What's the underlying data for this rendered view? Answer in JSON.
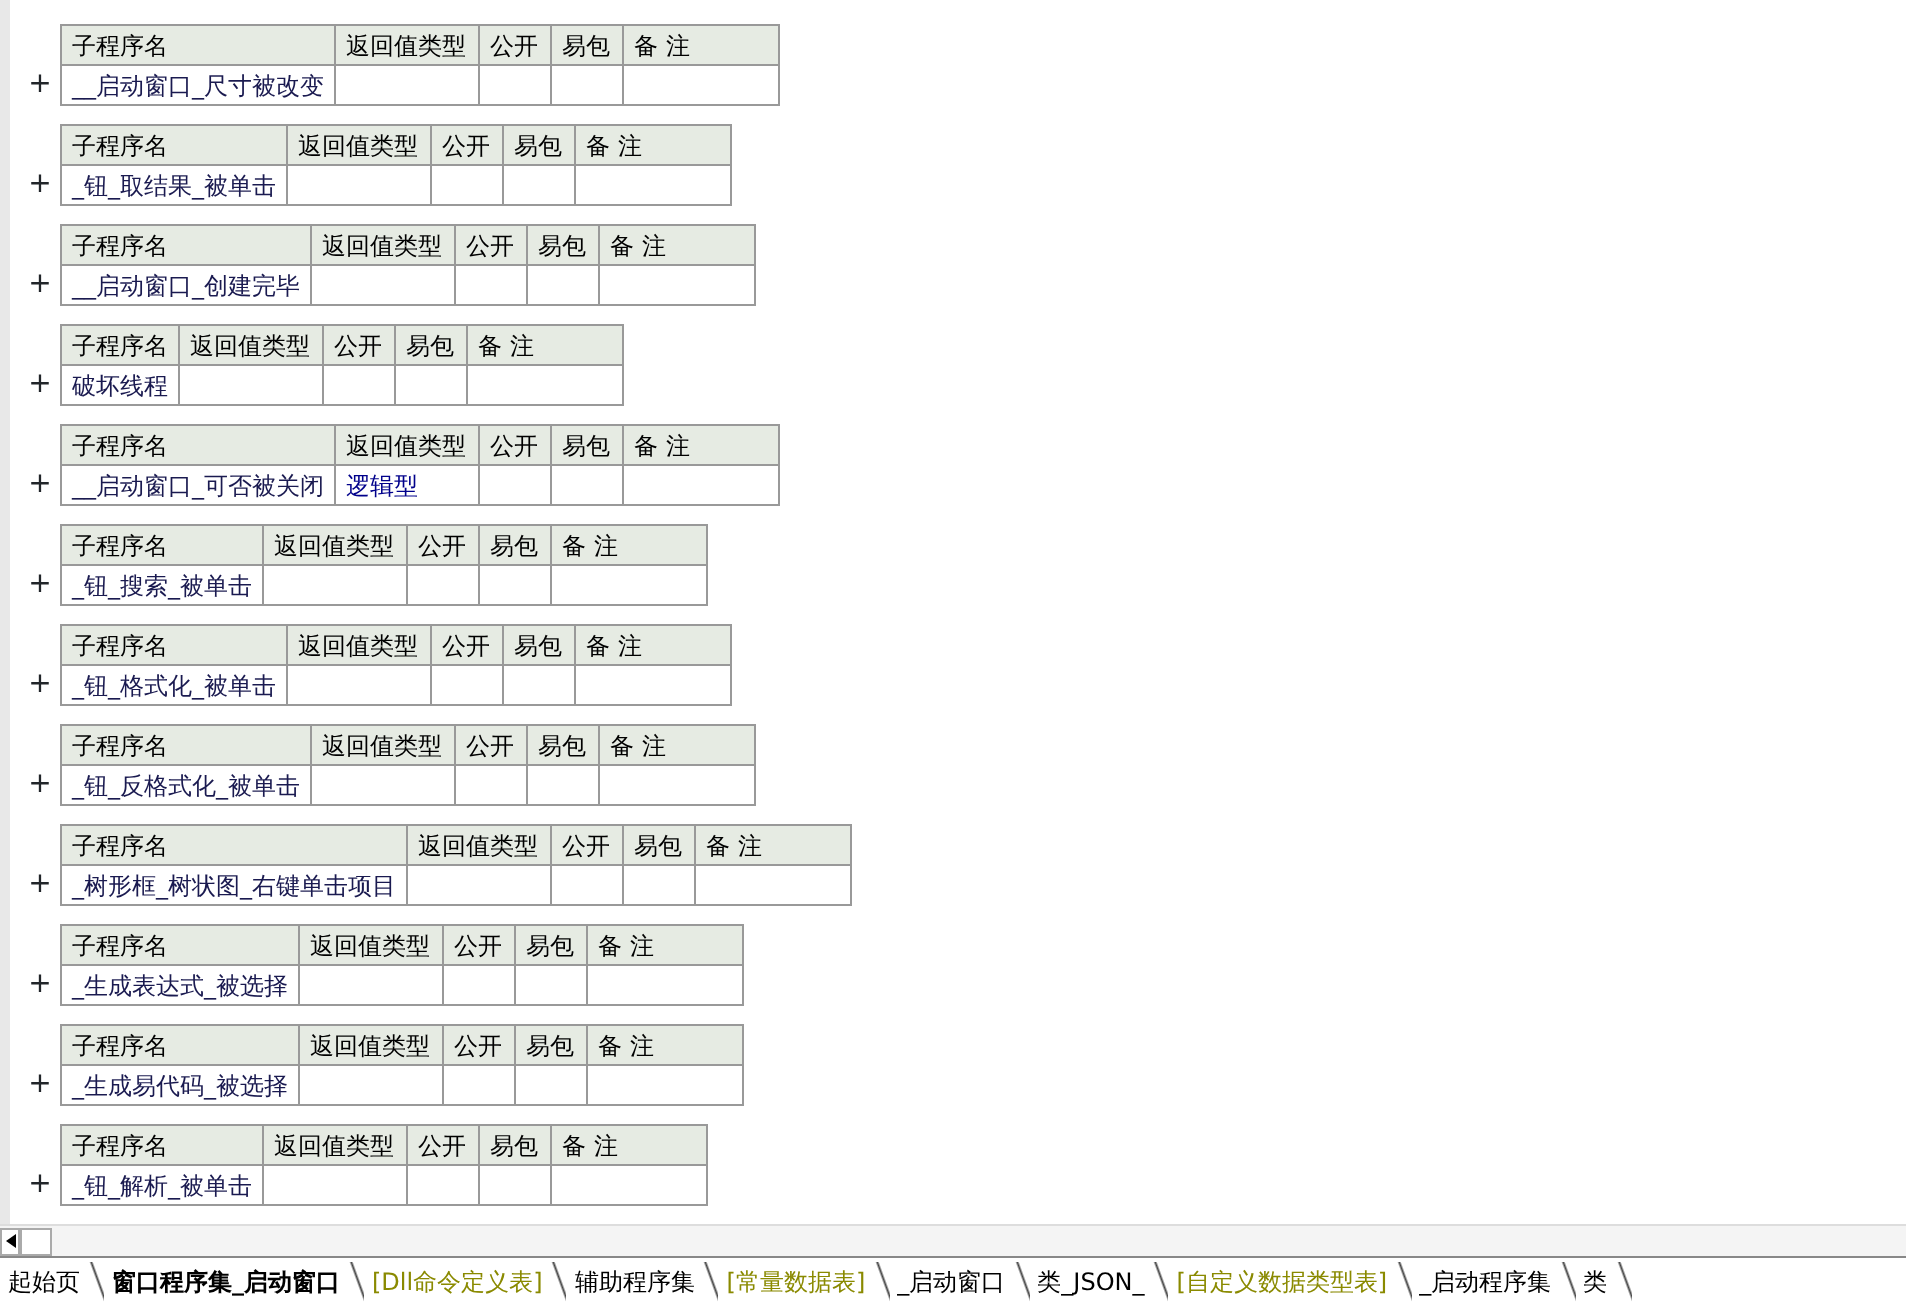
{
  "subprograms": [
    {
      "columns": [
        "子程序名",
        "返回值类型",
        "公开",
        "易包",
        "备 注"
      ],
      "name": "__启动窗口_尺寸被改变",
      "expand": "+"
    },
    {
      "columns": [
        "子程序名",
        "返回值类型",
        "公开",
        "易包",
        "备 注"
      ],
      "name": "_钮_取结果_被单击",
      "expand": "+"
    },
    {
      "columns": [
        "子程序名",
        "返回值类型",
        "公开",
        "易包",
        "备 注"
      ],
      "name": "__启动窗口_创建完毕",
      "expand": "+"
    },
    {
      "columns": [
        "子程序名",
        "返回值类型",
        "公开",
        "易包",
        "备 注"
      ],
      "name": "破坏线程",
      "expand": "+"
    },
    {
      "columns": [
        "子程序名",
        "返回值类型",
        "公开",
        "易包",
        "备 注"
      ],
      "name": "__启动窗口_可否被关闭",
      "return_type": "逻辑型",
      "expand": "+"
    },
    {
      "columns": [
        "子程序名",
        "返回值类型",
        "公开",
        "易包",
        "备 注"
      ],
      "name": "_钮_搜索_被单击",
      "expand": "+"
    },
    {
      "columns": [
        "子程序名",
        "返回值类型",
        "公开",
        "易包",
        "备 注"
      ],
      "name": "_钮_格式化_被单击",
      "expand": "+"
    },
    {
      "columns": [
        "子程序名",
        "返回值类型",
        "公开",
        "易包",
        "备 注"
      ],
      "name": "_钮_反格式化_被单击",
      "expand": "+"
    },
    {
      "columns": [
        "子程序名",
        "返回值类型",
        "公开",
        "易包",
        "备 注"
      ],
      "name": "_树形框_树状图_右键单击项目",
      "expand": "+"
    },
    {
      "columns": [
        "子程序名",
        "返回值类型",
        "公开",
        "易包",
        "备 注"
      ],
      "name": "_生成表达式_被选择",
      "expand": "+"
    },
    {
      "columns": [
        "子程序名",
        "返回值类型",
        "公开",
        "易包",
        "备 注"
      ],
      "name": "_生成易代码_被选择",
      "expand": "+"
    },
    {
      "columns": [
        "子程序名",
        "返回值类型",
        "公开",
        "易包",
        "备 注"
      ],
      "name": "_钮_解析_被单击",
      "expand": "+"
    }
  ],
  "tabs": [
    {
      "label": "起始页",
      "kind": "page",
      "selected": false
    },
    {
      "label": "窗口程序集_启动窗口",
      "kind": "program",
      "selected": true
    },
    {
      "label": "[Dll命令定义表]",
      "kind": "table",
      "selected": false
    },
    {
      "label": "辅助程序集",
      "kind": "program",
      "selected": false
    },
    {
      "label": "[常量数据表]",
      "kind": "table",
      "selected": false
    },
    {
      "label": "_启动窗口",
      "kind": "program",
      "selected": false
    },
    {
      "label": "类_JSON_",
      "kind": "program",
      "selected": false
    },
    {
      "label": "[自定义数据类型表]",
      "kind": "table",
      "selected": false
    },
    {
      "label": "_启动程序集",
      "kind": "program",
      "selected": false
    },
    {
      "label": "类",
      "kind": "program",
      "selected": false
    }
  ]
}
